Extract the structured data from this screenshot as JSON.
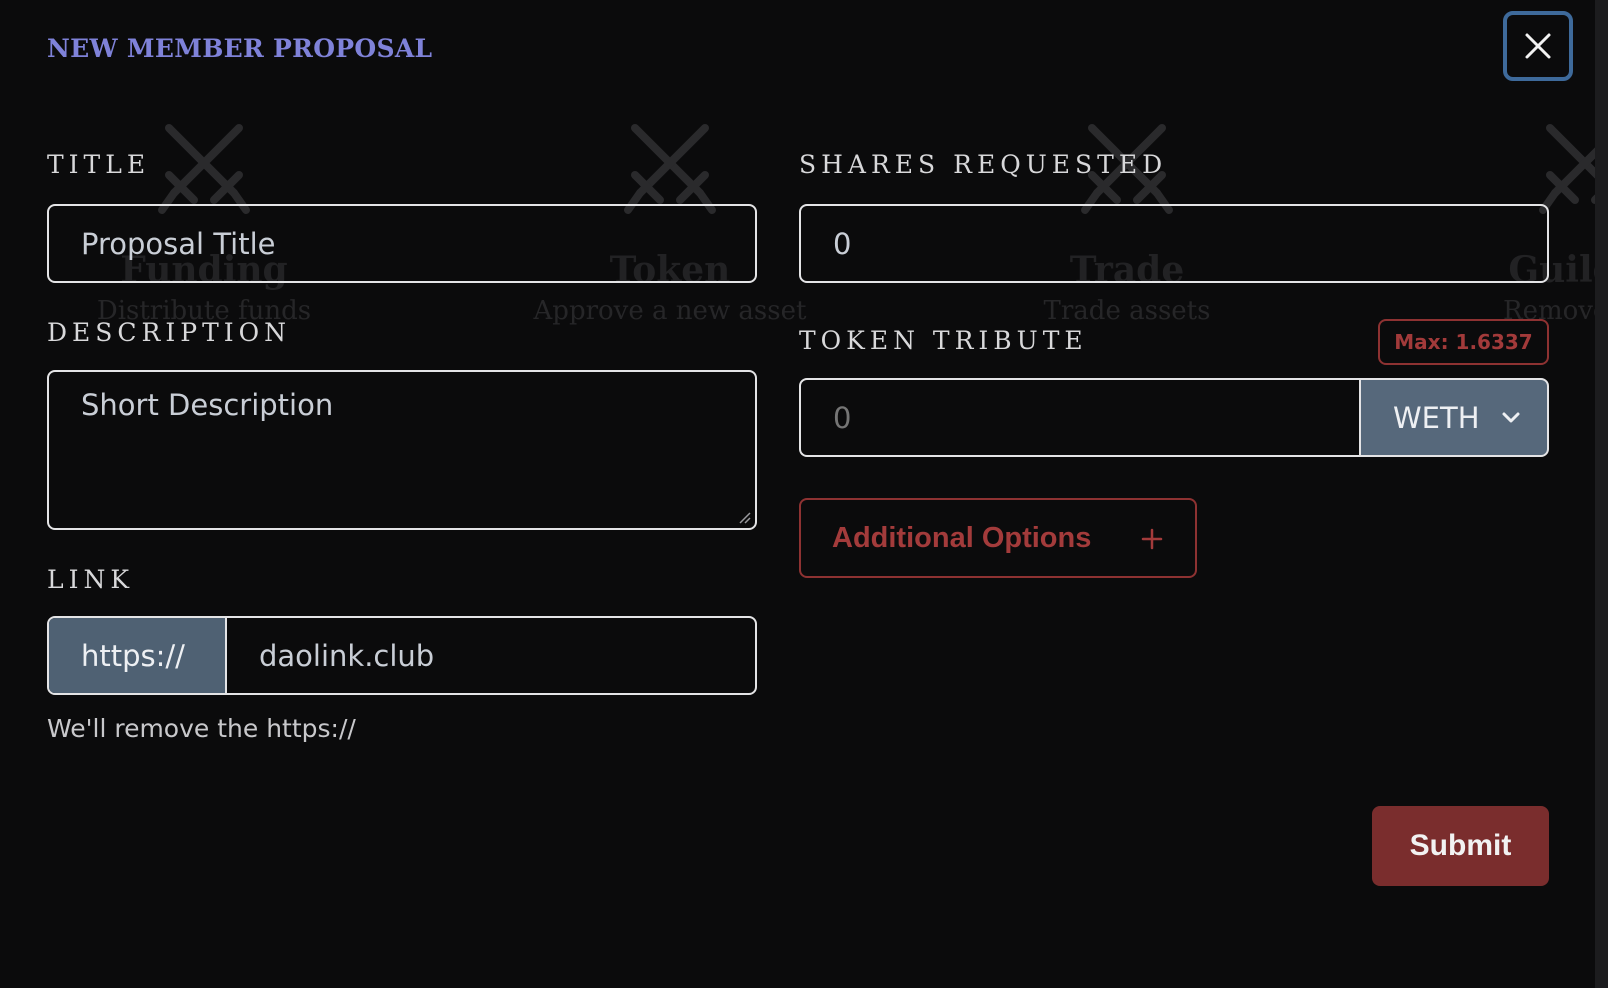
{
  "modal": {
    "title": "NEW MEMBER PROPOSAL",
    "close_icon": "close-icon"
  },
  "background_cards": [
    {
      "title": "Funding",
      "subtitle": "Distribute funds",
      "icon": "crossed-swords-icon"
    },
    {
      "title": "Token",
      "subtitle": "Approve a new asset",
      "icon": "crossed-swords-icon"
    },
    {
      "title": "Trade",
      "subtitle": "Trade assets",
      "icon": "crossed-swords-icon"
    },
    {
      "title": "Guild K",
      "subtitle": "Remove a M",
      "icon": "crossed-swords-icon"
    }
  ],
  "form": {
    "title": {
      "label": "TITLE",
      "placeholder": "Proposal Title",
      "value": ""
    },
    "description": {
      "label": "DESCRIPTION",
      "placeholder": "Short Description",
      "value": ""
    },
    "link": {
      "label": "LINK",
      "prefix": "https://",
      "placeholder": "daolink.club",
      "value": "",
      "helper": "We'll remove the https://"
    },
    "shares_requested": {
      "label": "SHARES REQUESTED",
      "placeholder": "0",
      "value": ""
    },
    "token_tribute": {
      "label": "TOKEN TRIBUTE",
      "placeholder": "0",
      "value": "",
      "max_label": "Max: 1.6337",
      "token": "WETH"
    },
    "additional_options_label": "Additional Options",
    "submit_label": "Submit"
  },
  "colors": {
    "background": "#0b0b0c",
    "title_accent": "#7f82d9",
    "danger": "#a33b3b",
    "submit_bg": "#7a2d2d",
    "addon_bg": "#4f6173",
    "close_border": "#3e6a9b"
  }
}
